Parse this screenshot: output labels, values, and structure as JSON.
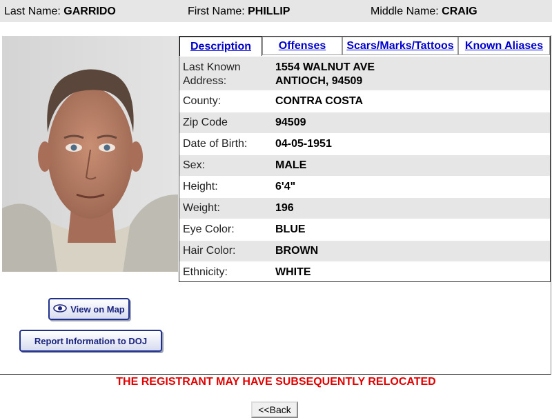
{
  "header": {
    "last_name_label": "Last Name:",
    "last_name": "GARRIDO",
    "first_name_label": "First Name:",
    "first_name": "PHILLIP",
    "middle_name_label": "Middle Name:",
    "middle_name": "CRAIG"
  },
  "tabs": [
    {
      "label": "Description",
      "active": true
    },
    {
      "label": "Offenses",
      "active": false
    },
    {
      "label": "Scars/Marks/Tattoos",
      "active": false
    },
    {
      "label": "Known Aliases",
      "active": false
    }
  ],
  "details": [
    {
      "label": "Last Known Address:",
      "value_line1": "1554 WALNUT AVE",
      "value_line2": "ANTIOCH, 94509"
    },
    {
      "label": "County:",
      "value": "CONTRA COSTA"
    },
    {
      "label": "Zip Code",
      "value": "94509"
    },
    {
      "label": "Date of Birth:",
      "value": "04-05-1951"
    },
    {
      "label": "Sex:",
      "value": "MALE"
    },
    {
      "label": "Height:",
      "value": "6'4\""
    },
    {
      "label": "Weight:",
      "value": "196"
    },
    {
      "label": "Eye Color:",
      "value": "BLUE"
    },
    {
      "label": "Hair Color:",
      "value": "BROWN"
    },
    {
      "label": "Ethnicity:",
      "value": "WHITE"
    }
  ],
  "buttons": {
    "view_map": "View on Map",
    "report": "Report Information to DOJ",
    "back": "<<Back"
  },
  "notice": "THE REGISTRANT MAY HAVE SUBSEQUENTLY RELOCATED",
  "colors": {
    "link": "#0000cc",
    "notice": "#e00000",
    "shade": "#e6e6e6",
    "button_border": "#1f2f8c"
  },
  "icons": {
    "view_map": "eye-icon"
  }
}
